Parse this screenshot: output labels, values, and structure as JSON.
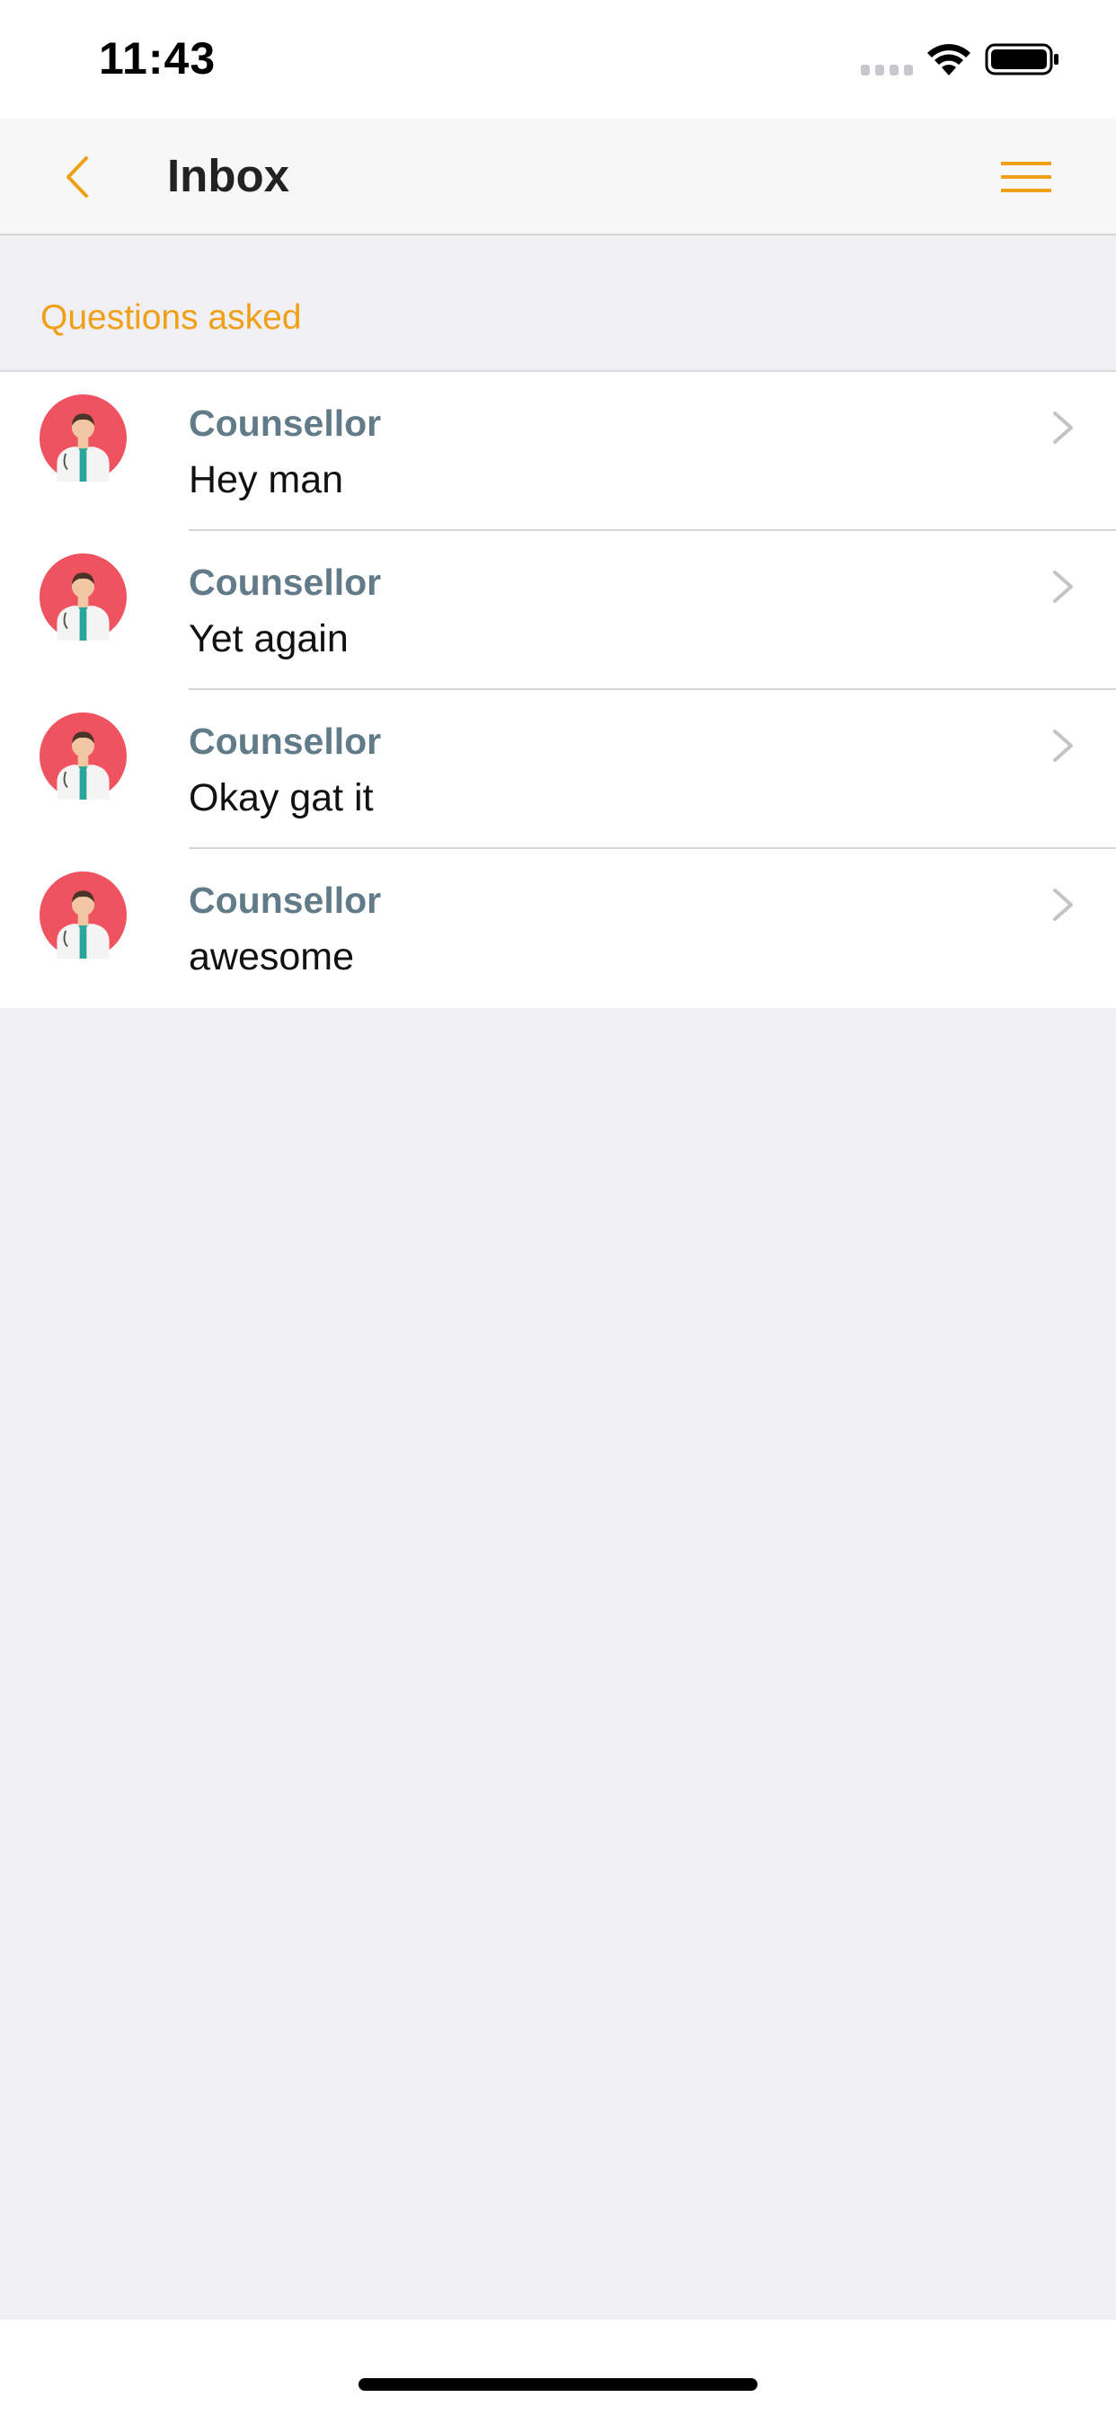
{
  "status_bar": {
    "time": "11:43"
  },
  "nav": {
    "title": "Inbox",
    "accent_color": "#f0a016"
  },
  "section": {
    "title": "Questions asked"
  },
  "inbox": {
    "items": [
      {
        "sender": "Counsellor",
        "message": "Hey man"
      },
      {
        "sender": "Counsellor",
        "message": "Yet again"
      },
      {
        "sender": "Counsellor",
        "message": "Okay gat it"
      },
      {
        "sender": "Counsellor",
        "message": "awesome"
      }
    ]
  }
}
